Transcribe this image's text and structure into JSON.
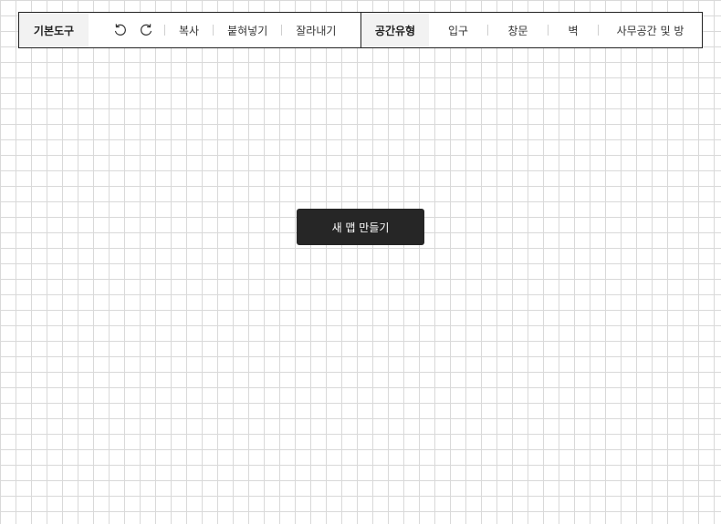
{
  "toolbar": {
    "basic_label": "기본도구",
    "undo_icon": "undo-icon",
    "redo_icon": "redo-icon",
    "copy_label": "복사",
    "paste_label": "붙혀넣기",
    "cut_label": "잘라내기",
    "space_type_label": "공간유형",
    "space_items": [
      "입구",
      "창문",
      "벽",
      "사무공간 및 방"
    ]
  },
  "main": {
    "create_map_label": "새 맵 만들기"
  },
  "colors": {
    "toolbar_border": "#222222",
    "section_label_bg": "#f2f2f2",
    "grid_line": "#d9d9d9",
    "button_bg": "#262626",
    "button_text": "#ffffff"
  }
}
